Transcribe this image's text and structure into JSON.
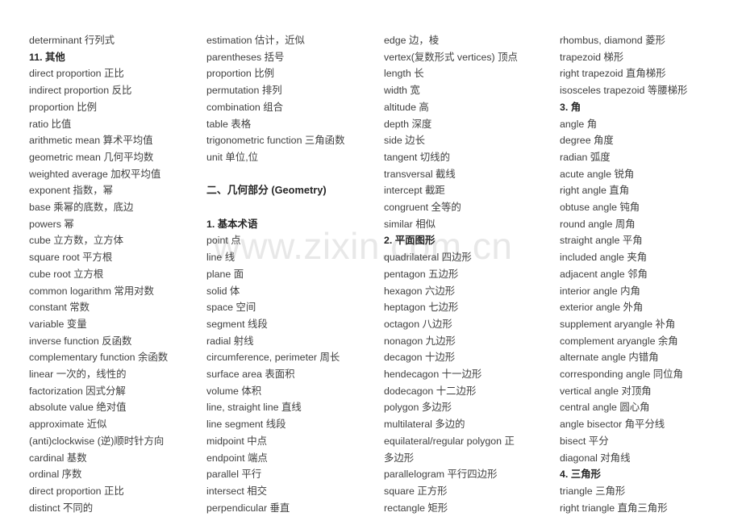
{
  "document": {
    "watermark": "www.zixin.com.cn",
    "watermark_color": "#e8e8e8",
    "text_color": "#3f3f3f",
    "heading_color": "#262626",
    "background_color": "#ffffff"
  },
  "columns": [
    {
      "id": "column-1",
      "entries": [
        {
          "text": "determinant 行列式",
          "type": "entry"
        },
        {
          "text": "11. 其他",
          "type": "heading"
        },
        {
          "text": "direct proportion 正比",
          "type": "entry"
        },
        {
          "text": "indirect proportion 反比",
          "type": "entry"
        },
        {
          "text": "proportion 比例",
          "type": "entry"
        },
        {
          "text": "ratio 比值",
          "type": "entry"
        },
        {
          "text": "arithmetic mean 算术平均值",
          "type": "entry"
        },
        {
          "text": "geometric mean 几何平均数",
          "type": "entry"
        },
        {
          "text": "weighted average 加权平均值",
          "type": "entry"
        },
        {
          "text": "exponent 指数，幂",
          "type": "entry"
        },
        {
          "text": "base 乘幂的底数，底边",
          "type": "entry"
        },
        {
          "text": "powers 幂",
          "type": "entry"
        },
        {
          "text": "cube 立方数，立方体",
          "type": "entry"
        },
        {
          "text": "square root 平方根",
          "type": "entry"
        },
        {
          "text": "cube root 立方根",
          "type": "entry"
        },
        {
          "text": "common logarithm 常用对数",
          "type": "entry"
        },
        {
          "text": "constant 常数",
          "type": "entry"
        },
        {
          "text": "variable 变量",
          "type": "entry"
        },
        {
          "text": "inverse function 反函数",
          "type": "entry"
        },
        {
          "text": "complementary function 余函数",
          "type": "entry"
        },
        {
          "text": "linear 一次的，线性的",
          "type": "entry"
        },
        {
          "text": "factorization 因式分解",
          "type": "entry"
        },
        {
          "text": "absolute value 绝对值",
          "type": "entry"
        },
        {
          "text": "approximate 近似",
          "type": "entry"
        },
        {
          "text": "(anti)clockwise (逆)顺时针方向",
          "type": "entry"
        },
        {
          "text": "cardinal 基数",
          "type": "entry"
        },
        {
          "text": "ordinal 序数",
          "type": "entry"
        },
        {
          "text": "direct proportion 正比",
          "type": "entry"
        },
        {
          "text": "distinct 不同的",
          "type": "entry"
        }
      ]
    },
    {
      "id": "column-2",
      "entries": [
        {
          "text": "estimation 估计，近似",
          "type": "entry"
        },
        {
          "text": "parentheses 括号",
          "type": "entry"
        },
        {
          "text": "proportion 比例",
          "type": "entry"
        },
        {
          "text": "permutation 排列",
          "type": "entry"
        },
        {
          "text": "combination 组合",
          "type": "entry"
        },
        {
          "text": "table 表格",
          "type": "entry"
        },
        {
          "text": "trigonometric function 三角函数",
          "type": "entry"
        },
        {
          "text": "unit 单位,位",
          "type": "entry"
        },
        {
          "text": "",
          "type": "spacer"
        },
        {
          "text": "二、几何部分 (Geometry)",
          "type": "major-heading"
        },
        {
          "text": "",
          "type": "spacer"
        },
        {
          "text": "1. 基本术语",
          "type": "heading"
        },
        {
          "text": "point 点",
          "type": "entry"
        },
        {
          "text": "line 线",
          "type": "entry"
        },
        {
          "text": "plane 面",
          "type": "entry"
        },
        {
          "text": "solid 体",
          "type": "entry"
        },
        {
          "text": "space 空间",
          "type": "entry"
        },
        {
          "text": "segment 线段",
          "type": "entry"
        },
        {
          "text": "radial 射线",
          "type": "entry"
        },
        {
          "text": "circumference, perimeter 周长",
          "type": "entry"
        },
        {
          "text": "surface area 表面积",
          "type": "entry"
        },
        {
          "text": "volume 体积",
          "type": "entry"
        },
        {
          "text": "line, straight line 直线",
          "type": "entry"
        },
        {
          "text": "line segment 线段",
          "type": "entry"
        },
        {
          "text": "midpoint 中点",
          "type": "entry"
        },
        {
          "text": "endpoint 端点",
          "type": "entry"
        },
        {
          "text": "parallel 平行",
          "type": "entry"
        },
        {
          "text": "intersect 相交",
          "type": "entry"
        },
        {
          "text": "perpendicular 垂直",
          "type": "entry"
        }
      ]
    },
    {
      "id": "column-3",
      "entries": [
        {
          "text": "edge 边，棱",
          "type": "entry"
        },
        {
          "text": "vertex(复数形式 vertices) 顶点",
          "type": "entry"
        },
        {
          "text": "length 长",
          "type": "entry"
        },
        {
          "text": "width 宽",
          "type": "entry"
        },
        {
          "text": "altitude 高",
          "type": "entry"
        },
        {
          "text": "depth 深度",
          "type": "entry"
        },
        {
          "text": "side 边长",
          "type": "entry"
        },
        {
          "text": "tangent 切线的",
          "type": "entry"
        },
        {
          "text": "transversal 截线",
          "type": "entry"
        },
        {
          "text": "intercept 截距",
          "type": "entry"
        },
        {
          "text": "congruent 全等的",
          "type": "entry"
        },
        {
          "text": "similar 相似",
          "type": "entry"
        },
        {
          "text": "2. 平面图形",
          "type": "heading"
        },
        {
          "text": "quadrilateral 四边形",
          "type": "entry"
        },
        {
          "text": "pentagon 五边形",
          "type": "entry"
        },
        {
          "text": "hexagon 六边形",
          "type": "entry"
        },
        {
          "text": "heptagon 七边形",
          "type": "entry"
        },
        {
          "text": "octagon 八边形",
          "type": "entry"
        },
        {
          "text": "nonagon 九边形",
          "type": "entry"
        },
        {
          "text": "decagon 十边形",
          "type": "entry"
        },
        {
          "text": "hendecagon 十一边形",
          "type": "entry"
        },
        {
          "text": "dodecagon 十二边形",
          "type": "entry"
        },
        {
          "text": "polygon 多边形",
          "type": "entry"
        },
        {
          "text": "multilateral 多边的",
          "type": "entry"
        },
        {
          "text": "equilateral/regular polygon 正多边形",
          "type": "wrap"
        },
        {
          "text": "parallelogram 平行四边形",
          "type": "entry"
        },
        {
          "text": "square 正方形",
          "type": "entry"
        },
        {
          "text": "rectangle 矩形",
          "type": "entry"
        }
      ]
    },
    {
      "id": "column-4",
      "entries": [
        {
          "text": "rhombus, diamond 菱形",
          "type": "entry"
        },
        {
          "text": "trapezoid 梯形",
          "type": "entry"
        },
        {
          "text": "right trapezoid 直角梯形",
          "type": "entry"
        },
        {
          "text": "isosceles trapezoid 等腰梯形",
          "type": "entry"
        },
        {
          "text": "3. 角",
          "type": "heading"
        },
        {
          "text": "angle 角",
          "type": "entry"
        },
        {
          "text": "degree 角度",
          "type": "entry"
        },
        {
          "text": "radian 弧度",
          "type": "entry"
        },
        {
          "text": "acute angle 锐角",
          "type": "entry"
        },
        {
          "text": "right angle 直角",
          "type": "entry"
        },
        {
          "text": "obtuse angle 钝角",
          "type": "entry"
        },
        {
          "text": "round angle 周角",
          "type": "entry"
        },
        {
          "text": "straight angle 平角",
          "type": "entry"
        },
        {
          "text": "included angle 夹角",
          "type": "entry"
        },
        {
          "text": "adjacent angle 邻角",
          "type": "entry"
        },
        {
          "text": "interior angle 内角",
          "type": "entry"
        },
        {
          "text": "exterior angle 外角",
          "type": "entry"
        },
        {
          "text": "supplement aryangle 补角",
          "type": "entry"
        },
        {
          "text": "complement aryangle 余角",
          "type": "entry"
        },
        {
          "text": "alternate angle 内错角",
          "type": "entry"
        },
        {
          "text": "corresponding angle 同位角",
          "type": "entry"
        },
        {
          "text": "vertical angle 对顶角",
          "type": "entry"
        },
        {
          "text": "central angle 圆心角",
          "type": "entry"
        },
        {
          "text": "angle bisector 角平分线",
          "type": "entry"
        },
        {
          "text": "bisect 平分",
          "type": "entry"
        },
        {
          "text": "diagonal 对角线",
          "type": "entry"
        },
        {
          "text": "4. 三角形",
          "type": "heading"
        },
        {
          "text": "triangle 三角形",
          "type": "entry"
        },
        {
          "text": "right triangle 直角三角形",
          "type": "entry"
        }
      ]
    }
  ]
}
